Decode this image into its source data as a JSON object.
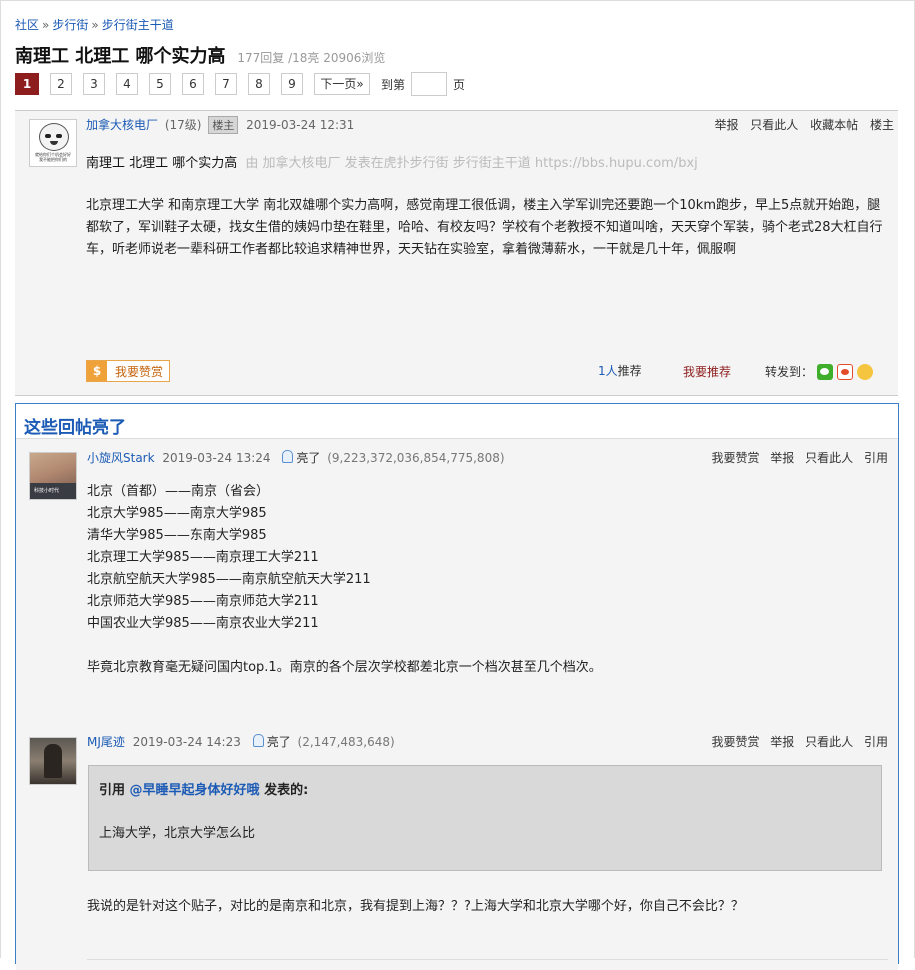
{
  "breadcrumb": {
    "items": [
      "社区",
      "步行街",
      "步行街主干道"
    ],
    "separator": "»"
  },
  "thread": {
    "title": "南理工 北理工 哪个实力高",
    "stats": "177回复 /18亮  20906浏览"
  },
  "pager": {
    "current": "1",
    "pages": [
      "2",
      "3",
      "4",
      "5",
      "6",
      "7",
      "8",
      "9"
    ],
    "next": "下一页»",
    "goto_label": "到第",
    "goto_unit": "页"
  },
  "main_post": {
    "author": "加拿大核电厂",
    "level": "(17级)",
    "owner_badge": "楼主",
    "time": "2019-03-24 12:31",
    "avatar_caption": "就给你们个机会好好\n我不能把你们的",
    "actions": [
      "举报",
      "只看此人",
      "收藏本帖",
      "楼主"
    ],
    "subject": "南理工 北理工 哪个实力高",
    "source": "由  加拿大核电厂  发表在虎扑步行街  步行街主干道  https://bbs.hupu.com/bxj",
    "body": "北京理工大学 和南京理工大学 南北双雄哪个实力高啊，感觉南理工很低调，楼主入学军训完还要跑一个10km跑步，早上5点就开始跑，腿都软了，军训鞋子太硬，找女生借的姨妈巾垫在鞋里，哈哈、有校友吗？学校有个老教授不知道叫啥，天天穿个军装，骑个老式28大杠自行车，听老师说老一辈科研工作者都比较追求精神世界，天天钻在实验室，拿着微薄薪水，一干就是几十年，佩服啊",
    "reward_label": "我要赞赏",
    "reward_icon": "coin-icon",
    "recommend_count": "1人",
    "recommend_label": "推荐",
    "my_recommend": "我要推荐",
    "share_label": "转发到："
  },
  "highlights": {
    "title": "这些回帖亮了",
    "replies": [
      {
        "author": "小旋风Stark",
        "time": "2019-03-24 13:24",
        "light_label": "亮了",
        "light_count": "(9,223,372,036,854,775,808)",
        "avatar_text": "科技小时代",
        "actions": [
          "我要赞赏",
          "举报",
          "只看此人",
          "引用"
        ],
        "lines": [
          "北京（首都）——南京（省会）",
          "北京大学985——南京大学985",
          "清华大学985——东南大学985",
          "北京理工大学985——南京理工大学211",
          "北京航空航天大学985——南京航空航天大学211",
          "北京师范大学985——南京师范大学211",
          "中国农业大学985——南京农业大学211",
          "",
          "毕竟北京教育毫无疑问国内top.1。南京的各个层次学校都差北京一个档次甚至几个档次。"
        ]
      },
      {
        "author": "MJ尾迹",
        "time": "2019-03-24 14:23",
        "light_label": "亮了",
        "light_count": "(2,147,483,648)",
        "actions": [
          "我要赞赏",
          "举报",
          "只看此人",
          "引用"
        ],
        "quote_prefix": "引用 ",
        "quote_user": "@早睡早起身体好好哦",
        "quote_suffix": " 发表的:",
        "quote_body": "上海大学，北京大学怎么比",
        "body": "我说的是针对这个贴子，对比的是南京和北京，我有提到上海？？?上海大学和北京大学哪个好，你自己不会比？？"
      }
    ]
  }
}
